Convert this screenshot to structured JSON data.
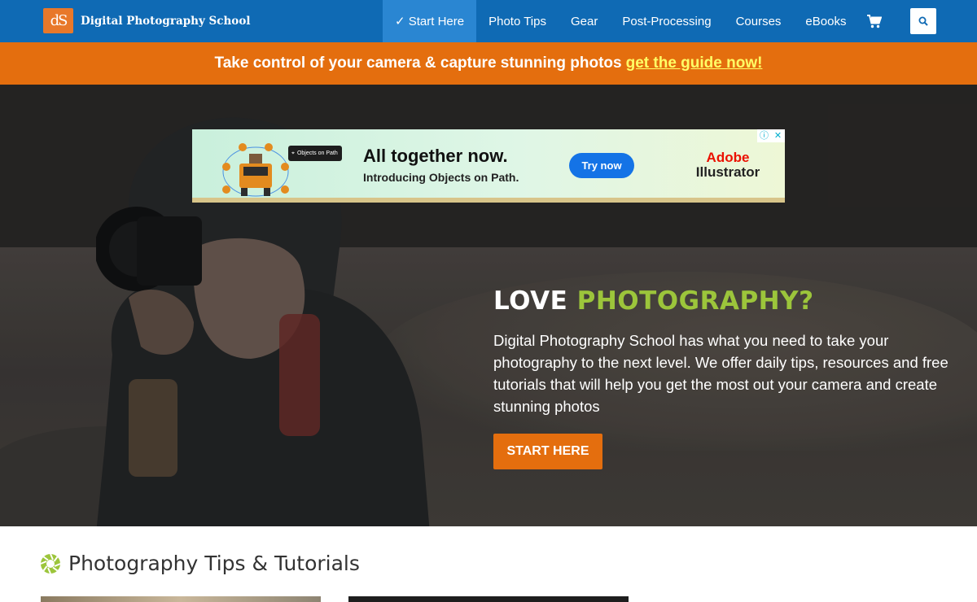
{
  "site": {
    "logo_mark": "dS",
    "name": "Digital Photography School"
  },
  "nav": {
    "items": [
      {
        "label": "✓ Start Here"
      },
      {
        "label": "Photo Tips"
      },
      {
        "label": "Gear"
      },
      {
        "label": "Post-Processing"
      },
      {
        "label": "Courses"
      },
      {
        "label": "eBooks"
      }
    ],
    "cart_icon": "shopping-cart-icon",
    "search_icon": "search-icon"
  },
  "promo": {
    "text": "Take control of your camera & capture stunning photos",
    "link": "get the guide now!"
  },
  "ad": {
    "headline": "All together now.",
    "subline": "Introducing Objects on Path.",
    "button": "Try now",
    "chip_label": "Objects on Path",
    "brand_line1": "Adobe",
    "brand_line2": "Illustrator",
    "info_icon": "ⓘ",
    "close_icon": "✕"
  },
  "hero": {
    "title_plain": "LOVE",
    "title_accent": "PHOTOGRAPHY?",
    "description": "Digital Photography School has what you need to take your photography to the next level. We offer daily tips, resources and free tutorials that will help you get the most out your camera and create stunning photos",
    "cta": "START HERE"
  },
  "section": {
    "title": "Photography Tips & Tutorials",
    "icon": "aperture-icon"
  },
  "colors": {
    "header_blue": "#0f6ab4",
    "active_nav": "#2a86d2",
    "orange": "#e46e0e",
    "link_yellow": "#ffff66",
    "accent_green": "#9cc53b",
    "adobe_red": "#eb1000",
    "ad_button_blue": "#1473e6"
  }
}
